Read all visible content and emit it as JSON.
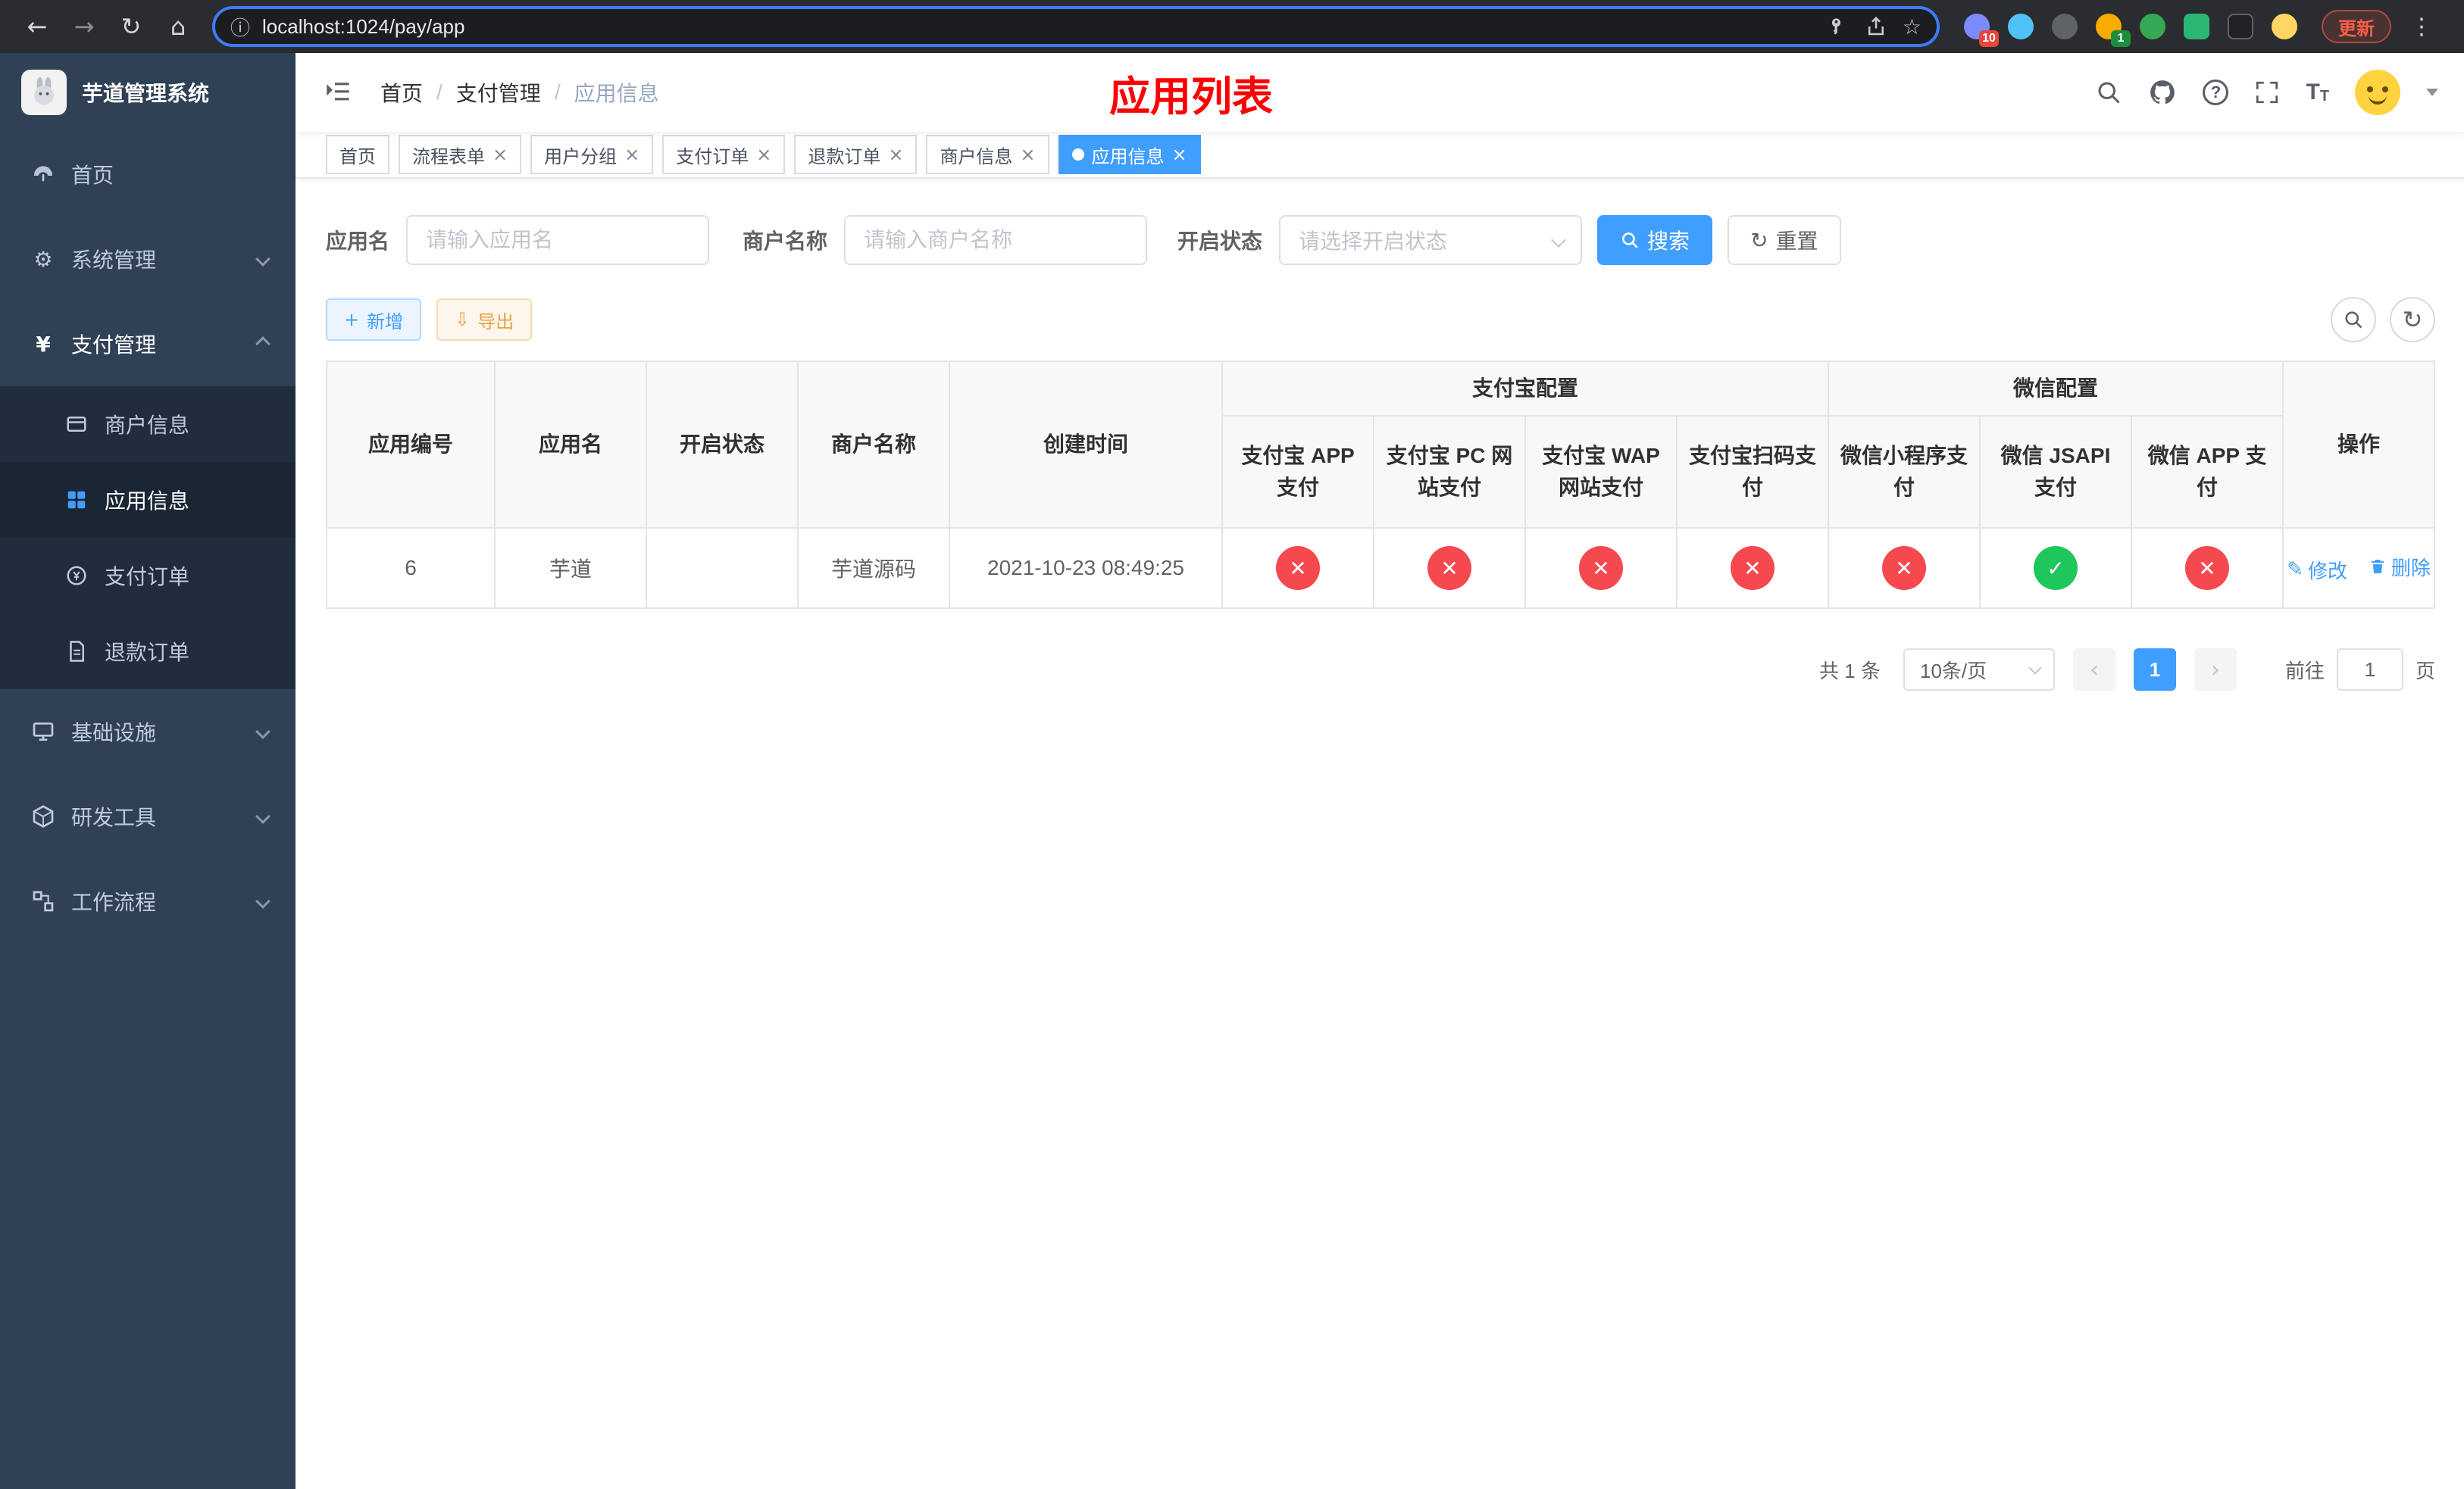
{
  "browser": {
    "url": "localhost:1024/pay/app",
    "update_button": "更新",
    "extension_badge_puzzle": "10",
    "extension_badge_translate": "1"
  },
  "app_title": "芋道管理系统",
  "sidebar": {
    "items": [
      {
        "label": "首页"
      },
      {
        "label": "系统管理"
      },
      {
        "label": "支付管理"
      },
      {
        "label": "基础设施"
      },
      {
        "label": "研发工具"
      },
      {
        "label": "工作流程"
      }
    ],
    "pay_children": [
      {
        "label": "商户信息"
      },
      {
        "label": "应用信息"
      },
      {
        "label": "支付订单"
      },
      {
        "label": "退款订单"
      }
    ]
  },
  "navbar": {
    "breadcrumb": [
      "首页",
      "支付管理",
      "应用信息"
    ],
    "page_title": "应用列表"
  },
  "tabs": [
    {
      "label": "首页"
    },
    {
      "label": "流程表单"
    },
    {
      "label": "用户分组"
    },
    {
      "label": "支付订单"
    },
    {
      "label": "退款订单"
    },
    {
      "label": "商户信息"
    },
    {
      "label": "应用信息"
    }
  ],
  "filters": {
    "app_name_label": "应用名",
    "app_name_placeholder": "请输入应用名",
    "merchant_label": "商户名称",
    "merchant_placeholder": "请输入商户名称",
    "status_label": "开启状态",
    "status_placeholder": "请选择开启状态",
    "search_button": "搜索",
    "reset_button": "重置"
  },
  "toolbar": {
    "add_button": "新增",
    "export_button": "导出"
  },
  "table": {
    "headers": {
      "app_id": "应用编号",
      "app_name": "应用名",
      "status": "开启状态",
      "merchant": "商户名称",
      "created": "创建时间",
      "alipay_group": "支付宝配置",
      "wechat_group": "微信配置",
      "alipay_app": "支付宝 APP 支付",
      "alipay_pc": "支付宝 PC 网站支付",
      "alipay_wap": "支付宝 WAP 网站支付",
      "alipay_qr": "支付宝扫码支付",
      "wechat_lite": "微信小程序支付",
      "wechat_jsapi": "微信 JSAPI 支付",
      "wechat_app": "微信 APP 支付",
      "actions": "操作"
    },
    "rows": [
      {
        "app_id": "6",
        "app_name": "芋道",
        "enabled": true,
        "merchant": "芋道源码",
        "created": "2021-10-23 08:49:25",
        "alipay_app": false,
        "alipay_pc": false,
        "alipay_wap": false,
        "alipay_qr": false,
        "wechat_lite": false,
        "wechat_jsapi": true,
        "wechat_app": false,
        "edit_label": "修改",
        "delete_label": "删除"
      }
    ]
  },
  "pagination": {
    "total": "共 1 条",
    "page_size": "10条/页",
    "page": "1",
    "goto_label": "前往",
    "goto_value": "1",
    "goto_suffix": "页"
  },
  "icons": {
    "back": "←",
    "forward": "→",
    "reload": "↻",
    "home": "⌂",
    "info": "ⓘ",
    "star": "☆",
    "menu_dots": "⋮",
    "gear": "⚙",
    "yen": "¥",
    "close": "×",
    "plus": "+",
    "download": "⇩",
    "refresh": "↻",
    "question": "?",
    "prev": "‹",
    "next": "›",
    "edit": "✎"
  },
  "status_icons": {
    "yes": "✓",
    "no": "✕"
  },
  "colors": {
    "accent": "#409eff",
    "danger": "#f5494f",
    "success": "#1fc65b",
    "title_red": "#ff0000",
    "sidebar_bg": "#304156",
    "submenu_bg": "#1f2d3d"
  }
}
